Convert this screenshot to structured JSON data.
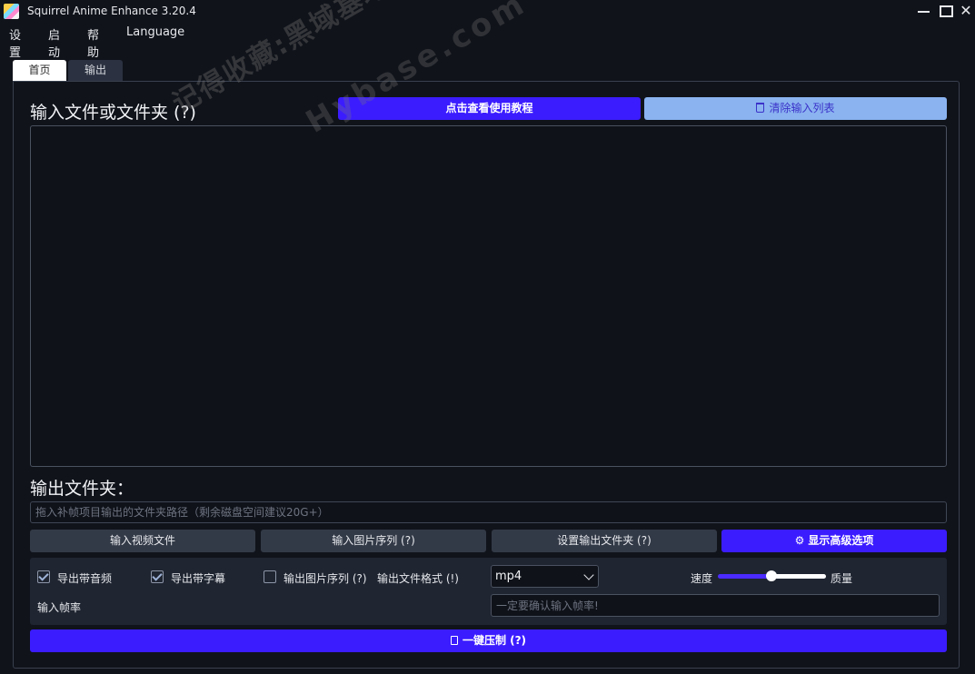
{
  "window": {
    "title": "Squirrel Anime Enhance 3.20.4",
    "min": "",
    "max": "",
    "close": "✕"
  },
  "menu": [
    "设置",
    "启动",
    "帮助",
    "Language"
  ],
  "tabs": [
    {
      "label": "首页",
      "active": true
    },
    {
      "label": "输出",
      "active": false
    }
  ],
  "input_section": {
    "heading": "输入文件或文件夹 (?)",
    "tutorial_button": "点击查看使用教程",
    "clear_button": "清除输入列表"
  },
  "output_section": {
    "heading": "输出文件夹：",
    "path_placeholder": "拖入补帧项目输出的文件夹路径（剩余磁盘空间建议20G+）"
  },
  "action_buttons": {
    "input_video": "输入视频文件",
    "input_sequence": "输入图片序列 (?)",
    "set_output_dir": "设置输出文件夹 (?)",
    "advanced": "显示高级选项"
  },
  "options": {
    "export_audio": {
      "label": "导出带音频",
      "checked": true
    },
    "export_subtitle": {
      "label": "导出带字幕",
      "checked": true
    },
    "output_sequence": {
      "label": "输出图片序列 (?)",
      "checked": false
    },
    "format_label": "输出文件格式 (!)",
    "format_value": "mp4",
    "speed_label": "速度",
    "quality_label": "质量",
    "speed_quality_position": 0.5,
    "fps_label": "输入帧率",
    "fps_placeholder": "一定要确认输入帧率!"
  },
  "run_button": "一键压制 (?)",
  "watermark": {
    "line1": "记得收藏:黑域基地",
    "line2": "Hybase.com"
  },
  "colors": {
    "accent": "#3b1cff",
    "clear_button": "#8ab3f0",
    "background": "#10131a"
  }
}
